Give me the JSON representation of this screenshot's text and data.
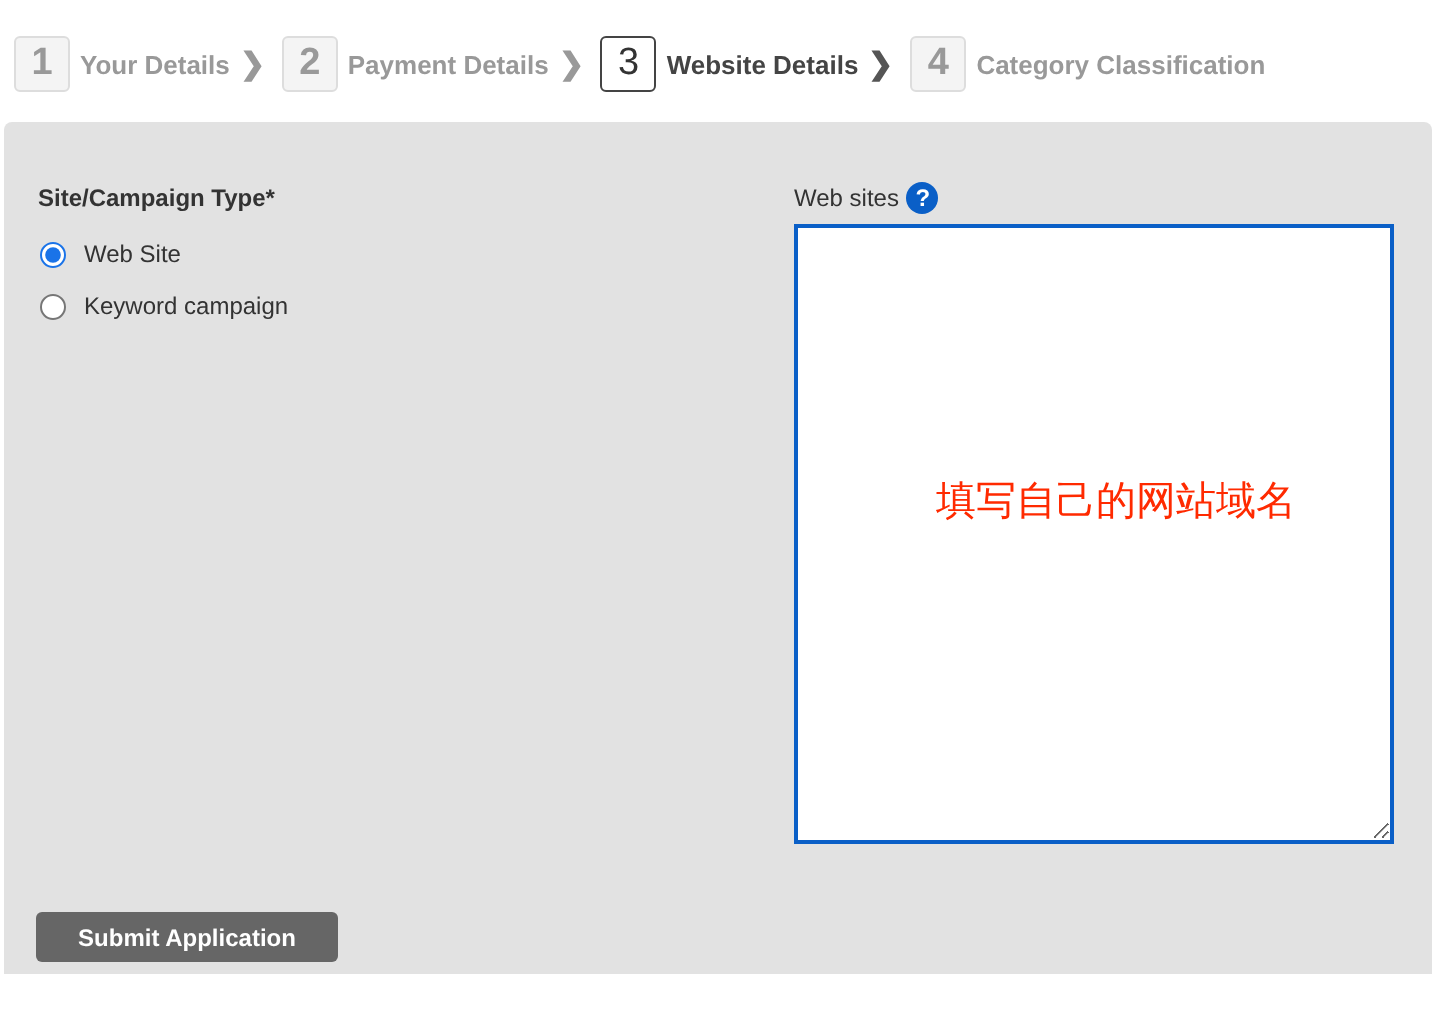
{
  "steps": [
    {
      "number": "1",
      "label": "Your Details",
      "selected": false,
      "arrow": "❯"
    },
    {
      "number": "2",
      "label": "Payment Details",
      "selected": false,
      "arrow": "❯"
    },
    {
      "number": "3",
      "label": "Website Details",
      "selected": true,
      "arrow": "❯"
    },
    {
      "number": "4",
      "label": "Category Classification",
      "selected": false
    }
  ],
  "form": {
    "type_label": "Site/Campaign Type*",
    "options": [
      {
        "label": "Web Site",
        "selected": true
      },
      {
        "label": "Keyword campaign",
        "selected": false
      }
    ],
    "websites_label": "Web sites",
    "help": "?",
    "annotation": "填写自己的网站域名",
    "submit": "Submit Application"
  }
}
